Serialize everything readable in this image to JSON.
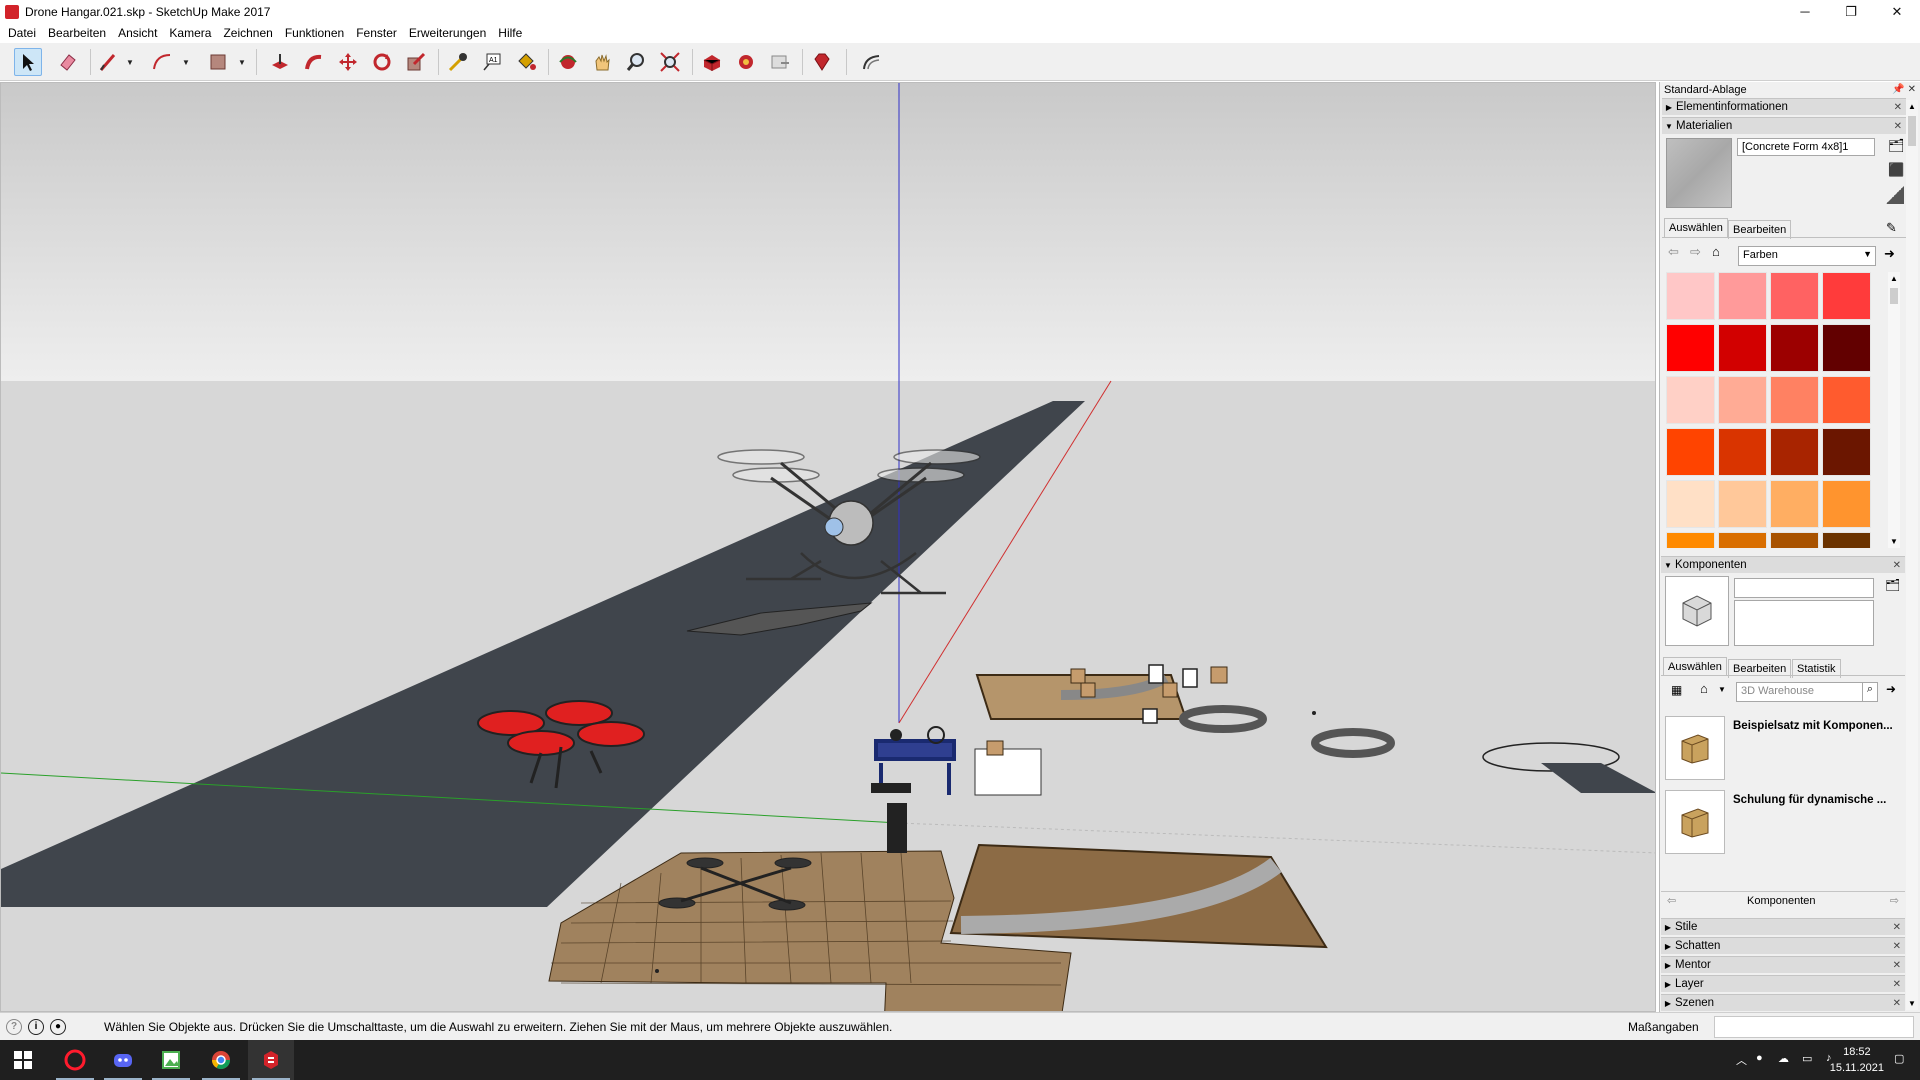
{
  "window": {
    "title": "Drone Hangar.021.skp - SketchUp Make 2017",
    "controls": [
      "─",
      "❐",
      "✕"
    ]
  },
  "menu": [
    "Datei",
    "Bearbeiten",
    "Ansicht",
    "Kamera",
    "Zeichnen",
    "Funktionen",
    "Fenster",
    "Erweiterungen",
    "Hilfe"
  ],
  "toolbar": {
    "tools": [
      {
        "name": "select-tool-icon",
        "selected": true
      },
      {
        "name": "eraser-tool-icon"
      },
      {
        "name": "line-tool-icon"
      },
      {
        "name": "arc-tool-icon"
      },
      {
        "name": "rectangle-tool-icon"
      },
      {
        "name": "push-pull-tool-icon"
      },
      {
        "name": "follow-me-tool-icon"
      },
      {
        "name": "move-tool-icon"
      },
      {
        "name": "rotate-tool-icon"
      },
      {
        "name": "scale-tool-icon"
      },
      {
        "name": "tape-measure-tool-icon"
      },
      {
        "name": "text-tool-icon"
      },
      {
        "name": "paint-bucket-tool-icon"
      },
      {
        "name": "orbit-tool-icon"
      },
      {
        "name": "pan-tool-icon"
      },
      {
        "name": "zoom-tool-icon"
      },
      {
        "name": "zoom-extents-tool-icon"
      },
      {
        "name": "3d-warehouse-icon"
      },
      {
        "name": "extension-warehouse-icon"
      },
      {
        "name": "share-model-icon"
      },
      {
        "name": "ruby-console-icon"
      },
      {
        "name": "sandbox-icon"
      }
    ]
  },
  "panel": {
    "title": "Standard-Ablage",
    "pin": "📌 ✕",
    "sections": {
      "entity_info": "Elementinformationen",
      "materials": "Materialien",
      "components": "Komponenten",
      "styles": "Stile",
      "shadows": "Schatten",
      "mentor": "Mentor",
      "layers": "Layer",
      "scenes": "Szenen"
    },
    "materials": {
      "current_name": "[Concrete Form 4x8]1",
      "tab_select": "Auswählen",
      "tab_edit": "Bearbeiten",
      "library": "Farben",
      "swatches": [
        [
          "#ffc7c7",
          "#ff9a9a",
          "#ff6262",
          "#ff3b3b"
        ],
        [
          "#ff0000",
          "#d20000",
          "#9c0000",
          "#620000"
        ],
        [
          "#ffd0c6",
          "#ffab95",
          "#ff8162",
          "#ff5b2e"
        ],
        [
          "#ff4400",
          "#d93400",
          "#a82400",
          "#6b1600"
        ],
        [
          "#ffe0c6",
          "#ffc89a",
          "#ffae62",
          "#ff942e"
        ],
        [
          "#ff8a00",
          "#d96e00",
          "#a85200",
          "#6b3300"
        ]
      ]
    },
    "components": {
      "tab_select": "Auswählen",
      "tab_edit": "Bearbeiten",
      "tab_stats": "Statistik",
      "search_placeholder": "3D Warehouse",
      "items": [
        "Beispielsatz mit Komponen...",
        "Schulung für dynamische ..."
      ],
      "footer": "Komponenten"
    }
  },
  "status": {
    "message": "Wählen Sie Objekte aus. Drücken Sie die Umschalttaste, um die Auswahl zu erweitern. Ziehen Sie mit der Maus, um mehrere Objekte auszuwählen.",
    "vcb_label": "Maßangaben",
    "vcb_value": ""
  },
  "taskbar": {
    "time": "18:52",
    "date": "15.11.2021"
  }
}
